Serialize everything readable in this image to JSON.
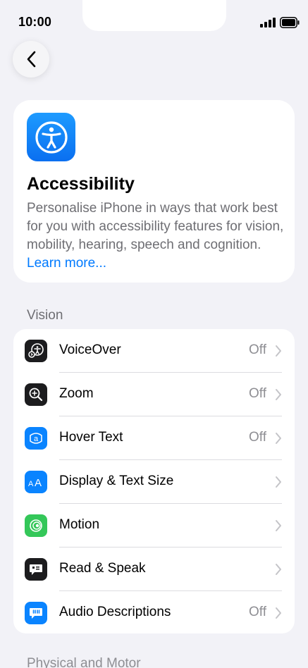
{
  "status_bar": {
    "time": "10:00"
  },
  "header": {
    "title": "Accessibility",
    "description": "Personalise iPhone in ways that work best for you with accessibility features for vision, mobility, hearing, speech and cognition.",
    "learn_more": "Learn more..."
  },
  "vision": {
    "section_title": "Vision",
    "items": [
      {
        "label": "VoiceOver",
        "value": "Off",
        "icon": "voiceover-icon",
        "icon_color": "#1c1c1e"
      },
      {
        "label": "Zoom",
        "value": "Off",
        "icon": "zoom-icon",
        "icon_color": "#1c1c1e"
      },
      {
        "label": "Hover Text",
        "value": "Off",
        "icon": "hover-text-icon",
        "icon_color": "#0a84ff"
      },
      {
        "label": "Display & Text Size",
        "value": "",
        "icon": "display-text-size-icon",
        "icon_color": "#0a84ff"
      },
      {
        "label": "Motion",
        "value": "",
        "icon": "motion-icon",
        "icon_color": "#34c759"
      },
      {
        "label": "Read & Speak",
        "value": "",
        "icon": "read-speak-icon",
        "icon_color": "#1c1c1e"
      },
      {
        "label": "Audio Descriptions",
        "value": "Off",
        "icon": "audio-descriptions-icon",
        "icon_color": "#0a84ff"
      }
    ]
  },
  "next_section": {
    "title": "Physical and Motor"
  },
  "colors": {
    "accent": "#007aff",
    "background": "#f2f2f7",
    "secondary_text": "#6e6e73"
  }
}
